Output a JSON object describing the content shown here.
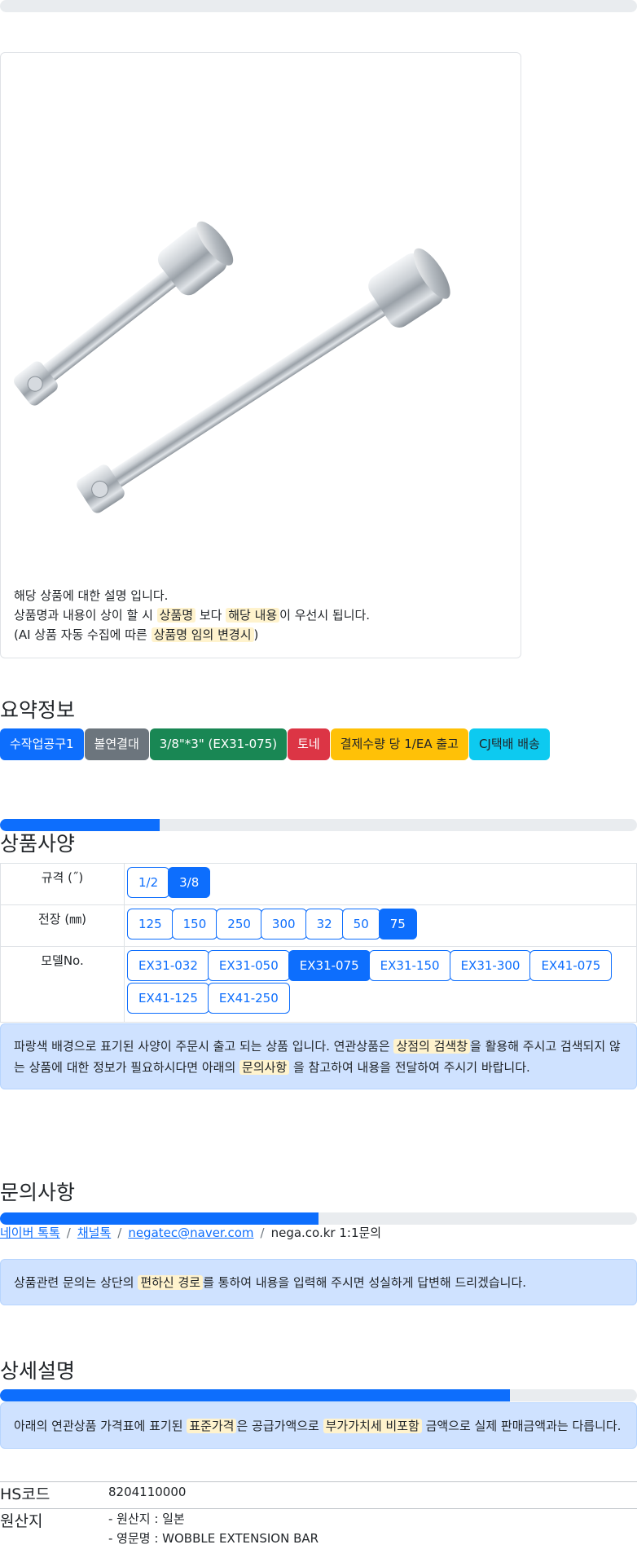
{
  "card": {
    "desc_line1": "해당 상품에 대한 설명 입니다.",
    "desc_line2_a": "상품명과 내용이 상이 할 시 ",
    "desc_line2_hl1": "상품명",
    "desc_line2_b": " 보다 ",
    "desc_line2_hl2": "해당 내용",
    "desc_line2_c": "이 우선시 됩니다.",
    "desc_line3_a": "(AI 상품 자동 수집에 따른 ",
    "desc_line3_hl": "상품명 임의 변경시",
    "desc_line3_b": ")"
  },
  "summary": {
    "title": "요약정보",
    "badges": [
      {
        "label": "수작업공구1",
        "color": "#0d6efd"
      },
      {
        "label": "볼연결대",
        "color": "#6c757d"
      },
      {
        "label": "3/8\"*3\" (EX31-075)",
        "color": "#198754"
      },
      {
        "label": "토네",
        "color": "#dc3545"
      },
      {
        "label": "결제수량 당 1/EA 출고",
        "color": "#ffc107"
      },
      {
        "label": "CJ택배 배송",
        "color": "#0dcaf0"
      }
    ]
  },
  "progress": {
    "spec_fill": 0.25,
    "inquiry_fill": 0.5,
    "detail_fill": 0.8
  },
  "spec": {
    "title": "상품사양",
    "rows": [
      {
        "label": "규격 (˝)",
        "options": [
          "1/2",
          "3/8"
        ],
        "selected": "3/8"
      },
      {
        "label": "전장 (㎜)",
        "options": [
          "125",
          "150",
          "250",
          "300",
          "32",
          "50",
          "75"
        ],
        "selected": "75"
      },
      {
        "label": "모델No.",
        "options": [
          "EX31-032",
          "EX31-050",
          "EX31-075",
          "EX31-150",
          "EX31-300",
          "EX41-075",
          "EX41-125",
          "EX41-250"
        ],
        "selected": "EX31-075"
      }
    ],
    "notice_a": "파랑색 배경으로 표기된 사양이 주문시 출고 되는 상품 입니다. 연관상품은 ",
    "notice_hl1": "상점의 검색창",
    "notice_b": "을 활용해 주시고 검색되지 않는 상품에 대한 정보가 필요하시다면 아래의 ",
    "notice_hl2": "문의사항",
    "notice_c": " 을 참고하여 내용을 전달하여 주시기 바랍니다."
  },
  "inquiry": {
    "title": "문의사항",
    "links": [
      "네이버 톡톡",
      "채널톡",
      "negatec@naver.com"
    ],
    "plain": "nega.co.kr 1:1문의",
    "notice_a": "상품관련 문의는 상단의 ",
    "notice_hl": "편하신 경로",
    "notice_b": "를 통하여 내용을 입력해 주시면 성실하게 답변해 드리겠습니다."
  },
  "detail": {
    "title": "상세설명",
    "notice_a": "아래의 연관상품 가격표에 표기된 ",
    "notice_hl1": "표준가격",
    "notice_b": "은 공급가액으로 ",
    "notice_hl2": "부가가치세 비포함",
    "notice_c": " 금액으로 실제 판매금액과는 다릅니다.",
    "hs_key": "HS코드",
    "hs_val": "8204110000",
    "origin_key": "원산지",
    "origin_line1": "- 원산지 : 일본",
    "origin_line2": "- 영문명 : WOBBLE EXTENSION BAR"
  }
}
